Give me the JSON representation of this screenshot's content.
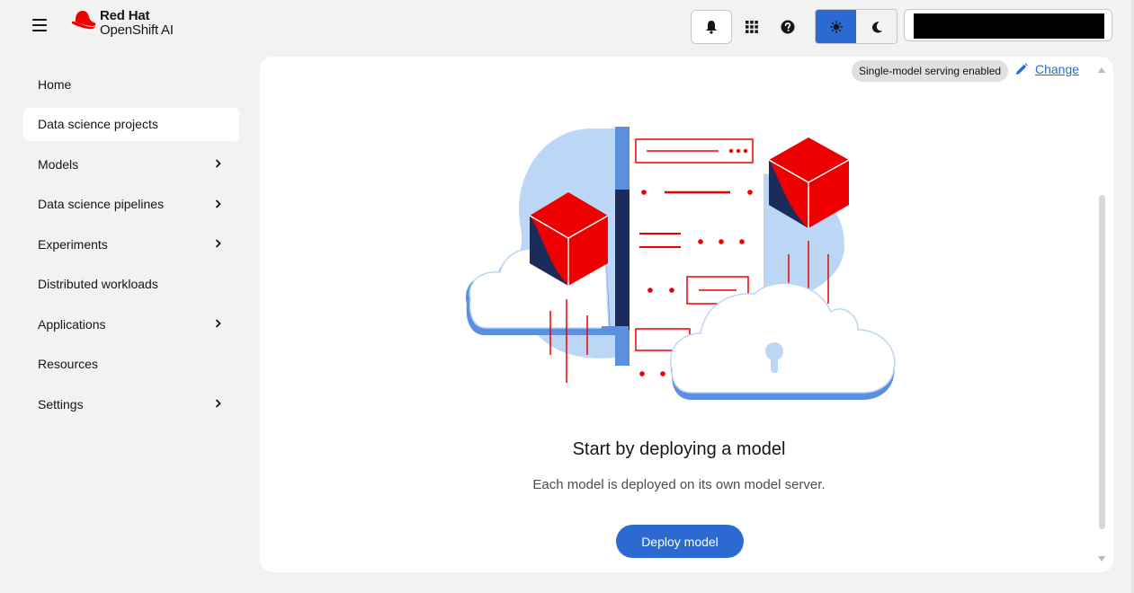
{
  "header": {
    "brand_line1": "Red Hat",
    "brand_line2": "OpenShift AI",
    "icons": [
      "menu-icon",
      "bell-icon",
      "grid-icon",
      "help-icon",
      "sun-icon",
      "moon-icon"
    ]
  },
  "sidebar": {
    "items": [
      {
        "label": "Home",
        "expandable": false,
        "active": false
      },
      {
        "label": "Data science projects",
        "expandable": false,
        "active": true
      },
      {
        "label": "Models",
        "expandable": true,
        "active": false
      },
      {
        "label": "Data science pipelines",
        "expandable": true,
        "active": false
      },
      {
        "label": "Experiments",
        "expandable": true,
        "active": false
      },
      {
        "label": "Distributed workloads",
        "expandable": false,
        "active": false
      },
      {
        "label": "Applications",
        "expandable": true,
        "active": false
      },
      {
        "label": "Resources",
        "expandable": false,
        "active": false
      },
      {
        "label": "Settings",
        "expandable": true,
        "active": false
      }
    ]
  },
  "main": {
    "serving_badge": "Single-model serving enabled",
    "change_label": "Change",
    "empty_title": "Start by deploying a model",
    "empty_body": "Each model is deployed on its own model server.",
    "deploy_label": "Deploy model"
  },
  "colors": {
    "accent": "#2b6bd1",
    "brand_red": "#ee0000",
    "navy": "#1a2c5b",
    "light_blue": "#bcd6f5"
  }
}
